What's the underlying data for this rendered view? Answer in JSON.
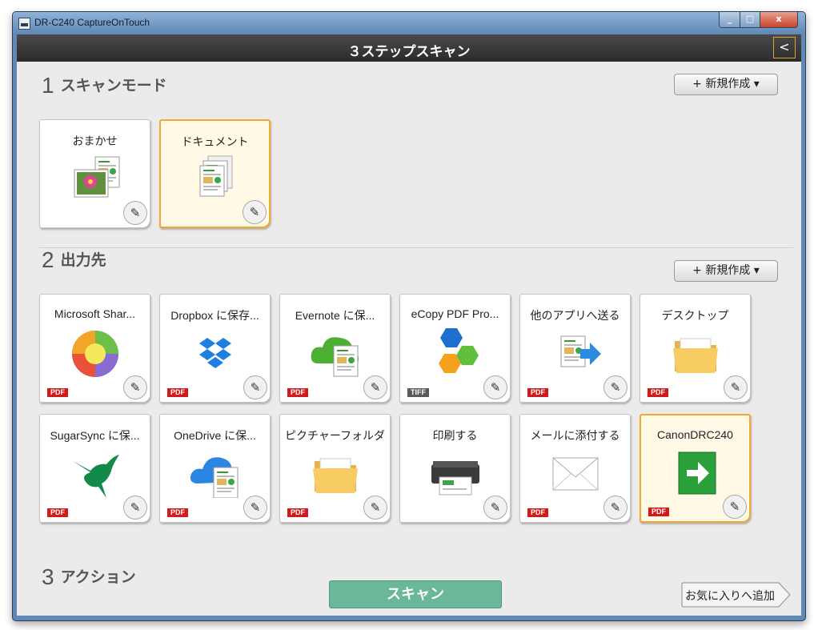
{
  "window": {
    "title": "DR-C240 CaptureOnTouch",
    "minimize": "_",
    "maximize": "□",
    "close": "x"
  },
  "header": {
    "title": "３ステップスキャン",
    "back": "<"
  },
  "section1": {
    "number": "1",
    "label": "スキャンモード",
    "new_button": "+ 新規作成 ▾",
    "cards": [
      {
        "label": "おまかせ",
        "icon": "photo-document-icon",
        "selected": false
      },
      {
        "label": "ドキュメント",
        "icon": "document-stack-icon",
        "selected": true
      }
    ]
  },
  "section2": {
    "number": "2",
    "label": "出力先",
    "new_button": "+ 新規作成 ▾",
    "cards": [
      {
        "label": "Microsoft Shar...",
        "icon": "sharepoint-icon",
        "format": "PDF",
        "selected": false
      },
      {
        "label": "Dropbox に保存...",
        "icon": "dropbox-icon",
        "format": "PDF",
        "selected": false
      },
      {
        "label": "Evernote に保...",
        "icon": "evernote-cloud-icon",
        "format": "PDF",
        "selected": false
      },
      {
        "label": "eCopy PDF Pro...",
        "icon": "ecopy-hexagon-icon",
        "format": "TIFF",
        "selected": false
      },
      {
        "label": "他のアプリへ送る",
        "icon": "send-to-app-icon",
        "format": "PDF",
        "selected": false
      },
      {
        "label": "デスクトップ",
        "icon": "desktop-folder-icon",
        "format": "PDF",
        "selected": false
      },
      {
        "label": "SugarSync に保...",
        "icon": "sugarsync-hummingbird-icon",
        "format": "PDF",
        "selected": false
      },
      {
        "label": "OneDrive に保...",
        "icon": "onedrive-cloud-icon",
        "format": "PDF",
        "selected": false
      },
      {
        "label": "ピクチャーフォルダー",
        "icon": "pictures-folder-icon",
        "format": "PDF",
        "selected": false
      },
      {
        "label": "印刷する",
        "icon": "printer-icon",
        "format": "",
        "selected": false
      },
      {
        "label": "メールに添付する",
        "icon": "mail-envelope-icon",
        "format": "PDF",
        "selected": false
      },
      {
        "label": "CanonDRC240",
        "icon": "green-arrow-icon",
        "format": "PDF",
        "selected": true
      }
    ]
  },
  "section3": {
    "number": "3",
    "label": "アクション",
    "scan_button": "スキャン",
    "favorite_button": "お気に入りへ追加"
  },
  "edit_glyph": "✎",
  "colors": {
    "accent_orange": "#f0a830",
    "scan_green": "#6ab89a",
    "pdf_red": "#d21a1a",
    "header_dark": "#2b2b2b"
  }
}
